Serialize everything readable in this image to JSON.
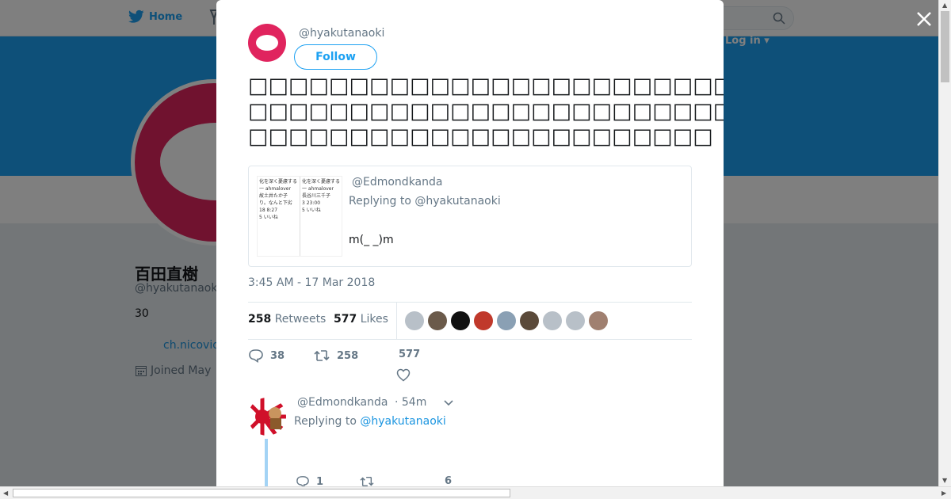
{
  "nav": {
    "home_label": "Home",
    "login_label": "Log in ▾"
  },
  "profile": {
    "name": "百田直樹",
    "handle": "@hyakutanaoki",
    "bio": "30",
    "link": "ch.nicovid",
    "joined": "Joined May"
  },
  "tweet": {
    "handle": "@hyakutanaoki",
    "follow_label": "Follow",
    "text": "□□□□□□□□□□□□□□□□□□□□□□□□□□□□□□□□□□□□□□□□□□□□□□□□□□□□□□□□□□□□□□□□□□□□□□□□□□□□□□□□□□□□□□□□□□□□□",
    "timestamp": "3:45 AM - 17 Mar 2018",
    "retweets_count": "258",
    "retweets_label": "Retweets",
    "likes_count": "577",
    "likes_label": "Likes",
    "reply_count": "38",
    "retweet_count": "258",
    "like_count": "577"
  },
  "quote": {
    "handle": "@Edmondkanda",
    "replying_to": "Replying to @hyakutanaoki",
    "text": "m(_ _)m",
    "thumb_col1": "化を深く憂慮する一 ahmalover\n故土井たか子\nり。なんと下劣\n18 8:27\n5 いいね",
    "thumb_col2": "化を深く憂慮する一 ahmalover\n長谷川三千子\n3 23:00\n5 いいね"
  },
  "likers": [
    "#b8c0c8",
    "#6b5a4a",
    "#111111",
    "#c0392b",
    "#8aa0b4",
    "#5b4a3a",
    "#b8c0c8",
    "#b8c0c8",
    "#a08070"
  ],
  "reply": {
    "handle": "@Edmondkanda",
    "time": "· 54m",
    "replying_label": "Replying to",
    "replying_handle": "@hyakutanaoki",
    "reply_count": "1",
    "like_count": "6"
  },
  "colors": {
    "brand": "#1da1f2",
    "avatar": "#e0245e"
  }
}
